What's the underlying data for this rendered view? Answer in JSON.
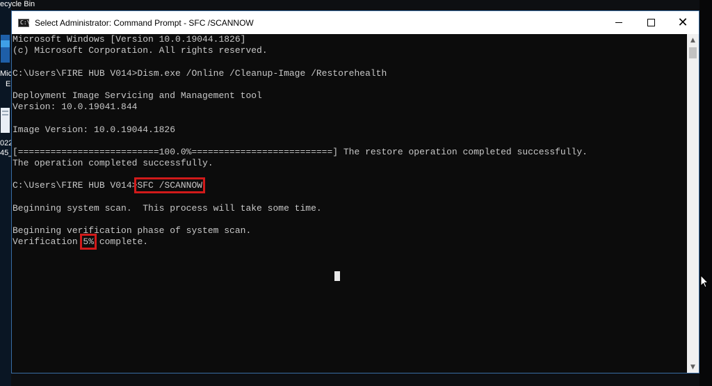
{
  "desktop": {
    "recycle_bin_label": "ecycle Bin",
    "edge_label_1": "Mic",
    "edge_label_2": "E",
    "date_fragment_1": "022",
    "date_fragment_2": "45_"
  },
  "window": {
    "title": "Select Administrator: Command Prompt - SFC  /SCANNOW",
    "icon": "cmd-icon",
    "minimize_icon": "minimize-icon",
    "maximize_icon": "maximize-icon",
    "close_glyph": "✕"
  },
  "console": {
    "lines": [
      "Microsoft Windows [Version 10.0.19044.1826]",
      "(c) Microsoft Corporation. All rights reserved.",
      "",
      "C:\\Users\\FIRE HUB V014>Dism.exe /Online /Cleanup-Image /Restorehealth",
      "",
      "Deployment Image Servicing and Management tool",
      "Version: 10.0.19041.844",
      "",
      "Image Version: 10.0.19044.1826",
      "",
      "[==========================100.0%==========================] The restore operation completed successfully.",
      "The operation completed successfully.",
      "",
      "",
      "",
      "Beginning system scan.  This process will take some time.",
      "",
      "Beginning verification phase of system scan.",
      ""
    ],
    "prompt_prefix": "C:\\Users\\FIRE HUB V014>",
    "command": "SFC /SCANNOW",
    "verification_prefix": "Verification ",
    "verification_percent": "5%",
    "verification_suffix": " complete."
  },
  "colors": {
    "console_bg": "#0c0c0c",
    "console_text": "#c8c8c8",
    "highlight": "#d11a1a"
  }
}
